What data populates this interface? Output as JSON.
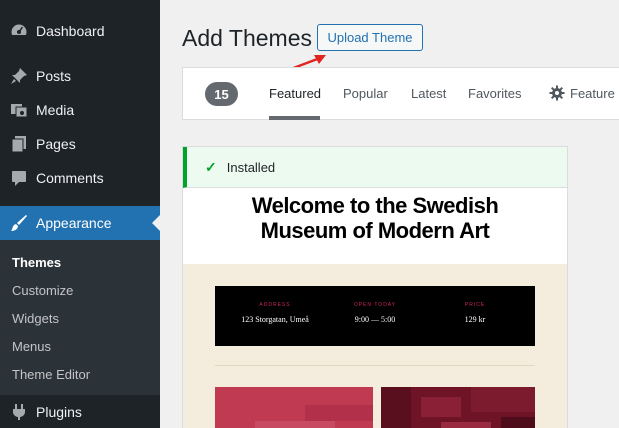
{
  "sidebar": {
    "items": [
      {
        "label": "Dashboard",
        "icon": "dashboard-icon"
      },
      {
        "label": "Posts",
        "icon": "pushpin-icon"
      },
      {
        "label": "Media",
        "icon": "media-icon"
      },
      {
        "label": "Pages",
        "icon": "pages-icon"
      },
      {
        "label": "Comments",
        "icon": "comments-icon"
      },
      {
        "label": "Appearance",
        "icon": "paintbrush-icon"
      },
      {
        "label": "Plugins",
        "icon": "plugin-icon"
      }
    ],
    "submenu": [
      "Themes",
      "Customize",
      "Widgets",
      "Menus",
      "Theme Editor"
    ]
  },
  "header": {
    "title": "Add Themes",
    "upload_label": "Upload Theme"
  },
  "filters": {
    "count": "15",
    "tabs": [
      "Featured",
      "Popular",
      "Latest",
      "Favorites"
    ],
    "feature_filter": "Feature F"
  },
  "theme": {
    "status": "Installed",
    "preview": {
      "title_line1": "Welcome to the Swedish",
      "title_line2": "Museum of Modern Art",
      "info": [
        {
          "heading": "ADDRESS",
          "value": "123 Storgatan, Umeå"
        },
        {
          "heading": "OPEN TODAY",
          "value": "9:00 — 5:00"
        },
        {
          "heading": "PRICE",
          "value": "129 kr"
        }
      ]
    }
  },
  "colors": {
    "sidebar_bg": "#1d2327",
    "accent": "#2271b1",
    "success": "#00a32a",
    "arrow": "#e02424"
  }
}
